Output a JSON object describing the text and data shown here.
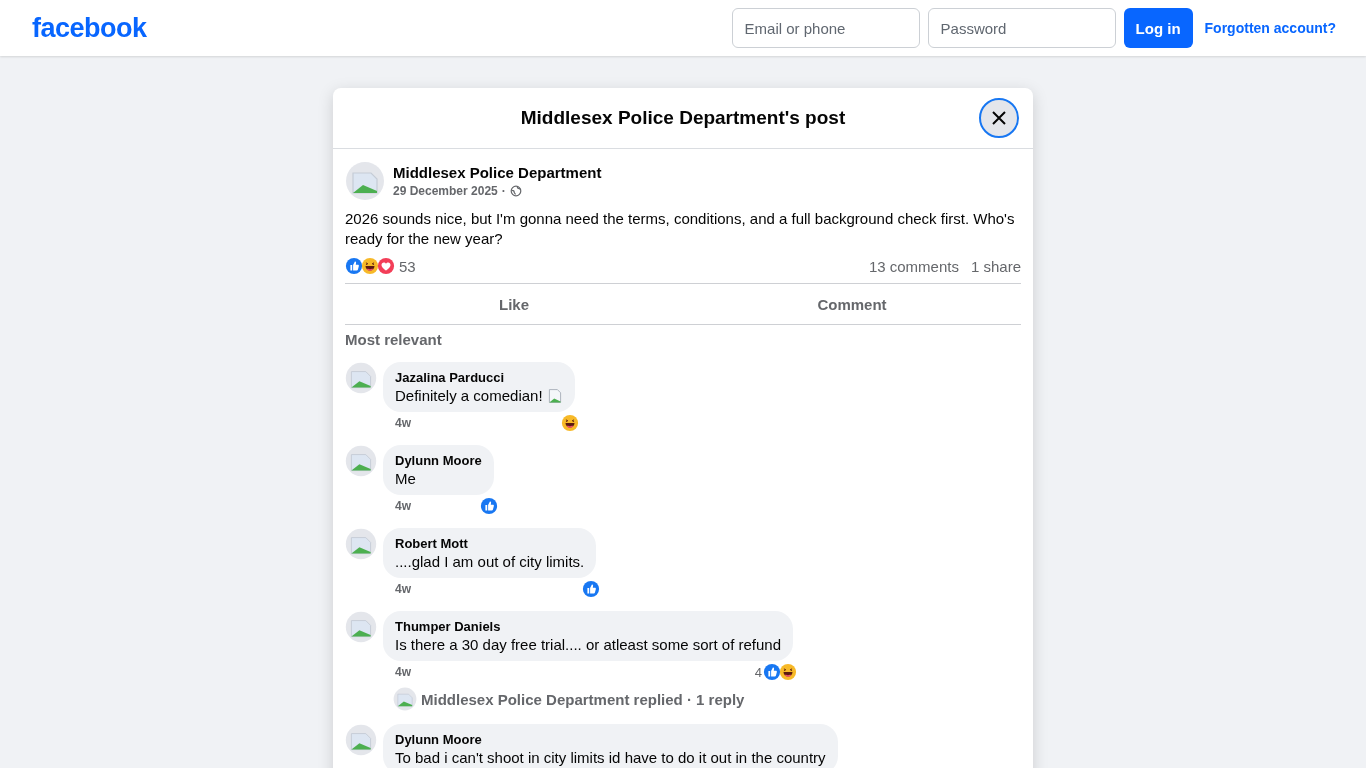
{
  "header": {
    "logo": "facebook",
    "email_placeholder": "Email or phone",
    "password_placeholder": "Password",
    "login": "Log in",
    "forgot": "Forgotten account?"
  },
  "modal": {
    "title": "Middlesex Police Department's post"
  },
  "post": {
    "author": "Middlesex Police Department",
    "date": "29 December 2025",
    "separator": "·",
    "text": "2026 sounds nice, but I'm gonna need the terms, conditions, and a full background check first. Who's ready for the new year?",
    "reactions": [
      {
        "kind": "like"
      },
      {
        "kind": "haha"
      },
      {
        "kind": "love"
      }
    ],
    "reaction_count": "53",
    "comments_count": "13 comments",
    "shares": "1 share"
  },
  "actions": [
    "Like",
    "Comment"
  ],
  "sort": "Most relevant",
  "comments": [
    {
      "name": "Jazalina Parducci",
      "text": "Definitely a comedian!",
      "has_image": true,
      "time": "4w",
      "reactions": [
        {
          "kind": "haha"
        }
      ]
    },
    {
      "name": "Dylunn Moore",
      "text": "Me",
      "has_image": false,
      "time": "4w",
      "reactions": [
        {
          "kind": "like"
        }
      ]
    },
    {
      "name": "Robert Mott",
      "text": "....glad I am out of city limits.",
      "has_image": false,
      "time": "4w",
      "reactions": [
        {
          "kind": "like"
        }
      ]
    },
    {
      "name": "Thumper Daniels",
      "text": "Is there a 30 day free trial.... or atleast some sort of refund",
      "has_image": false,
      "time": "4w",
      "reaction_count": "4",
      "reactions": [
        {
          "kind": "like"
        },
        {
          "kind": "haha"
        }
      ],
      "replies": "Middlesex Police Department replied · 1 reply"
    },
    {
      "name": "Dylunn Moore",
      "text": "To bad i can't shoot in city limits id have to do it out in the country",
      "has_image": false
    }
  ]
}
